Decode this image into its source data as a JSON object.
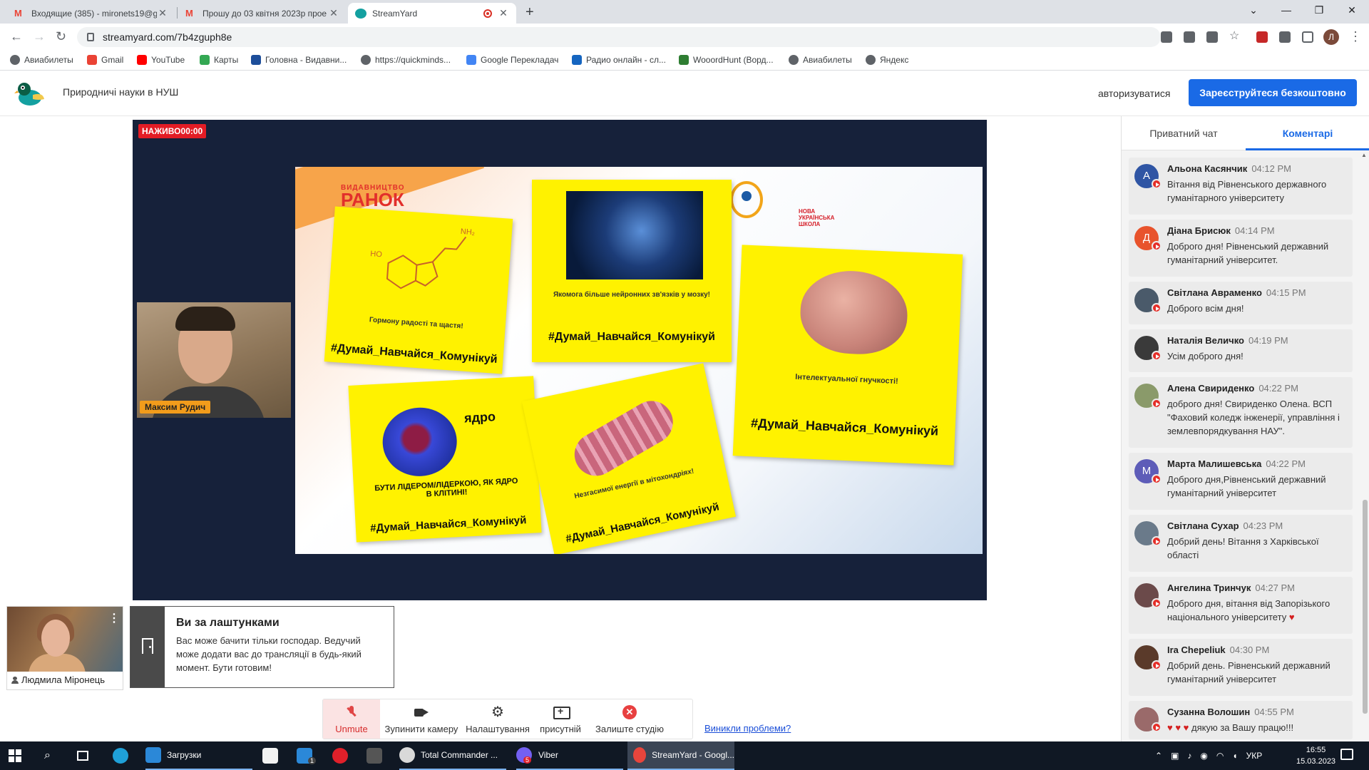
{
  "browser": {
    "tabs": [
      {
        "title": "Входящие (385) - mironets19@g"
      },
      {
        "title": "Прошу до 03 квітня 2023р прое"
      },
      {
        "title": "StreamYard"
      }
    ],
    "url": "streamyard.com/7b4zguph8e",
    "bookmarks": [
      "Авиабилеты",
      "Gmail",
      "YouTube",
      "Карты",
      "Головна - Видавни...",
      "https://quickminds...",
      "Google Переклaдач",
      "Радио онлайн - сл...",
      "WooordHunt (Ворд...",
      "Авиабилеты",
      "Яндекс"
    ],
    "profile_initial": "Л"
  },
  "header": {
    "show_title": "Природничі науки в НУШ",
    "login": "авторизуватися",
    "signup": "Зареєструйтеся безкоштовно"
  },
  "stage": {
    "live_label": "НАЖИВО",
    "live_time": "00:00",
    "presenter_name": "Максим Рудич",
    "slide": {
      "publisher_small": "ВИДАВНИЦТВО",
      "publisher_big": "РАНОК",
      "nus_logo_text": "НОВА УКРАЇНСЬКА ШКОЛА",
      "hashtag": "#Думай_Навчайся_Комунікуй",
      "card1_caption": "Гормону радості та щастя!",
      "card2_caption": "Якомога більше нейронних зв'язків у мозку!",
      "card3_caption": "Інтелектуальної гнучкості!",
      "card4_label": "ядро",
      "card4_caption": "БУТИ ЛІДЕРОМ/ЛІДЕРКОЮ, ЯК ЯДРО В КЛІТИНІ!",
      "card5_caption": "Незгасимої енергії в мітохондріях!"
    }
  },
  "guest": {
    "name": "Людмила Міронець"
  },
  "backstage": {
    "title": "Ви за лаштунками",
    "text": "Вас може бачити тільки господар. Ведучий може додати вас до трансляції в будь-який момент. Бути готовим!"
  },
  "controls": {
    "unmute": "Unmute",
    "camera": "Зупинити камеру",
    "settings": "Налаштування",
    "present": "присутній",
    "leave": "Залиште студію",
    "problems": "Виникли проблеми?"
  },
  "chat": {
    "tabs": {
      "private": "Приватний чат",
      "comments": "Коментарі"
    },
    "comments": [
      {
        "initial": "А",
        "color": "#2f55a4",
        "name": "Альона Касянчик",
        "time": "04:12 PM",
        "text": "Вітання від Рівненського державного гуманітарного університету"
      },
      {
        "initial": "Д",
        "color": "#e8532c",
        "name": "Діана Брисюк",
        "time": "04:14 PM",
        "text": "Доброго дня! Рівненський державний гуманітарний університет."
      },
      {
        "initial": "",
        "color": "#4a5a6a",
        "name": "Світлана Авраменко",
        "time": "04:15 PM",
        "text": "Доброго всім дня!"
      },
      {
        "initial": "",
        "color": "#3a3a3a",
        "name": "Наталія Величко",
        "time": "04:19 PM",
        "text": "Усім доброго дня!"
      },
      {
        "initial": "",
        "color": "#8a9a6a",
        "name": "Алена Свириденко",
        "time": "04:22 PM",
        "text": "доброго дня! Свириденко Олена. ВСП \"Фаховий коледж інженерії, управління і землевпорядкування НАУ\"."
      },
      {
        "initial": "М",
        "color": "#5d5cb8",
        "name": "Марта Малишевська",
        "time": "04:22 PM",
        "text": "Доброго дня,Рівненський державний гуманітарний університет"
      },
      {
        "initial": "",
        "color": "#6a7a8a",
        "name": "Світлана Сухар",
        "time": "04:23 PM",
        "text": "Добрий день! Вітання з Харківської області"
      },
      {
        "initial": "",
        "color": "#6b4a4a",
        "name": "Ангелина Тринчук",
        "time": "04:27 PM",
        "text": "Доброго дня, вітання від Запорізького національного університету"
      },
      {
        "initial": "",
        "color": "#5a3a2a",
        "name": "Ira Chepeliuk",
        "time": "04:30 PM",
        "text": "Добрий день. Рівненський державний гуманітарний університет"
      },
      {
        "initial": "",
        "color": "#9a6a6a",
        "name": "Сузанна Волошин",
        "time": "04:55 PM",
        "text": "дякую за Вашу працю!!!"
      }
    ]
  },
  "taskbar": {
    "downloads": "Загрузки",
    "total_commander": "Total Commander ...",
    "viber": "Viber",
    "viber_badge": "5",
    "mail_badge": "1",
    "streamyard": "StreamYard - Googl...",
    "lang": "УКР",
    "time": "16:55",
    "date": "15.03.2023"
  }
}
